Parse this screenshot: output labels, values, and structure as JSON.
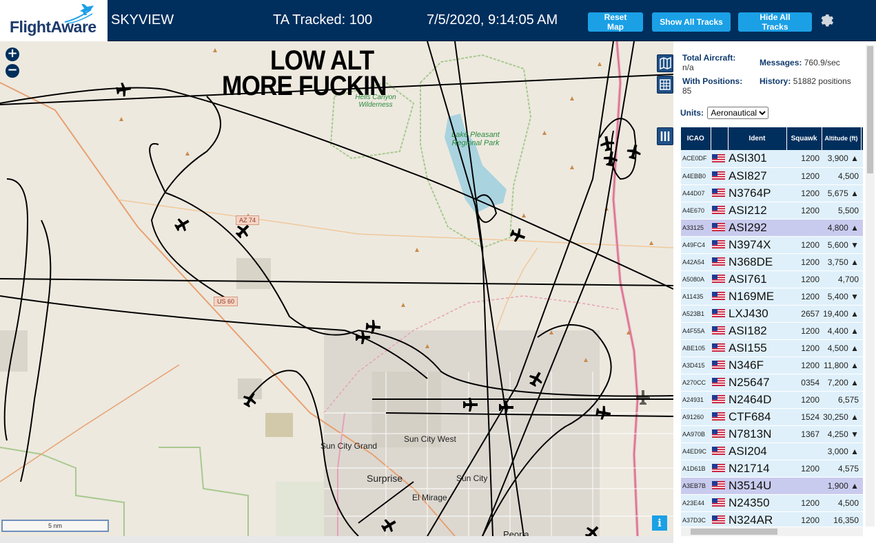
{
  "header": {
    "logo_text": "FlightAware",
    "site_name": "SKYVIEW",
    "tracked": "TA Tracked: 100",
    "datetime": "7/5/2020, 9:14:05 AM",
    "buttons": {
      "reset_map": "Reset Map",
      "show_tracks": "Show All Tracks",
      "hide_tracks": "Hide All Tracks"
    },
    "accent_color": "#1ba0e6",
    "bg_color": "#002f5d"
  },
  "map": {
    "overlay_line1": "LOW ALT",
    "overlay_line2": "MORE FUCKIN",
    "zoom_in": "+",
    "zoom_out": "−",
    "scale_label": "5 nm",
    "info_label": "i",
    "labels": {
      "hells_canyon": "Hells Canyon Wilderness",
      "lake_pleasant": "Lake Pleasant Regional Park",
      "sun_city_grand": "Sun City Grand",
      "sun_city_west": "Sun City West",
      "surprise": "Surprise",
      "sun_city": "Sun City",
      "el_mirage": "El Mirage",
      "peoria": "Peoria",
      "az74": "AZ 74",
      "us60": "US 60"
    }
  },
  "stats": {
    "total_label": "Total Aircraft:",
    "total_value": "n/a",
    "messages_label": "Messages:",
    "messages_value": "760.9/sec",
    "positions_label": "With Positions:",
    "positions_value": "85",
    "history_label": "History:",
    "history_value": "51882 positions"
  },
  "units": {
    "label": "Units:",
    "selected": "Aeronautical"
  },
  "table": {
    "headers": {
      "icao": "ICAO",
      "ident": "Ident",
      "squawk": "Squawk",
      "altitude": "Altitude (ft)"
    },
    "rows": [
      {
        "icao": "ACE0DF",
        "ident": "ASI301",
        "squawk": "1200",
        "alt": "3,900 ▲",
        "sel": false
      },
      {
        "icao": "A4EBB0",
        "ident": "ASI827",
        "squawk": "1200",
        "alt": "4,500",
        "sel": false
      },
      {
        "icao": "A44D07",
        "ident": "N3764P",
        "squawk": "1200",
        "alt": "5,675 ▲",
        "sel": false
      },
      {
        "icao": "A4E670",
        "ident": "ASI212",
        "squawk": "1200",
        "alt": "5,500",
        "sel": false
      },
      {
        "icao": "A33125",
        "ident": "ASI292",
        "squawk": "",
        "alt": "4,800 ▲",
        "sel": true
      },
      {
        "icao": "A49FC4",
        "ident": "N3974X",
        "squawk": "1200",
        "alt": "5,600 ▼",
        "sel": false
      },
      {
        "icao": "A42A54",
        "ident": "N368DE",
        "squawk": "1200",
        "alt": "3,750 ▲",
        "sel": false
      },
      {
        "icao": "A5080A",
        "ident": "ASI761",
        "squawk": "1200",
        "alt": "4,700",
        "sel": false
      },
      {
        "icao": "A11435",
        "ident": "N169ME",
        "squawk": "1200",
        "alt": "5,400 ▼",
        "sel": false
      },
      {
        "icao": "A523B1",
        "ident": "LXJ430",
        "squawk": "2657",
        "alt": "19,400 ▲",
        "sel": false
      },
      {
        "icao": "A4F55A",
        "ident": "ASI182",
        "squawk": "1200",
        "alt": "4,400 ▲",
        "sel": false
      },
      {
        "icao": "ABE105",
        "ident": "ASI155",
        "squawk": "1200",
        "alt": "4,500 ▲",
        "sel": false
      },
      {
        "icao": "A3D415",
        "ident": "N346F",
        "squawk": "1200",
        "alt": "11,800 ▲",
        "sel": false
      },
      {
        "icao": "A270CC",
        "ident": "N25647",
        "squawk": "0354",
        "alt": "7,200 ▲",
        "sel": false
      },
      {
        "icao": "A24931",
        "ident": "N2464D",
        "squawk": "1200",
        "alt": "6,575",
        "sel": false
      },
      {
        "icao": "A91260",
        "ident": "CTF684",
        "squawk": "1524",
        "alt": "30,250 ▲",
        "sel": false
      },
      {
        "icao": "AA970B",
        "ident": "N7813N",
        "squawk": "1367",
        "alt": "4,250 ▼",
        "sel": false
      },
      {
        "icao": "A4ED9C",
        "ident": "ASI204",
        "squawk": "",
        "alt": "3,000 ▲",
        "sel": false
      },
      {
        "icao": "A1D61B",
        "ident": "N21714",
        "squawk": "1200",
        "alt": "4,575",
        "sel": false
      },
      {
        "icao": "A3EB7B",
        "ident": "N3514U",
        "squawk": "",
        "alt": "1,900 ▲",
        "sel": true
      },
      {
        "icao": "A23E44",
        "ident": "N24350",
        "squawk": "1200",
        "alt": "4,500",
        "sel": false
      },
      {
        "icao": "A37D3C",
        "ident": "N324AR",
        "squawk": "1200",
        "alt": "16,350",
        "sel": false
      }
    ]
  }
}
